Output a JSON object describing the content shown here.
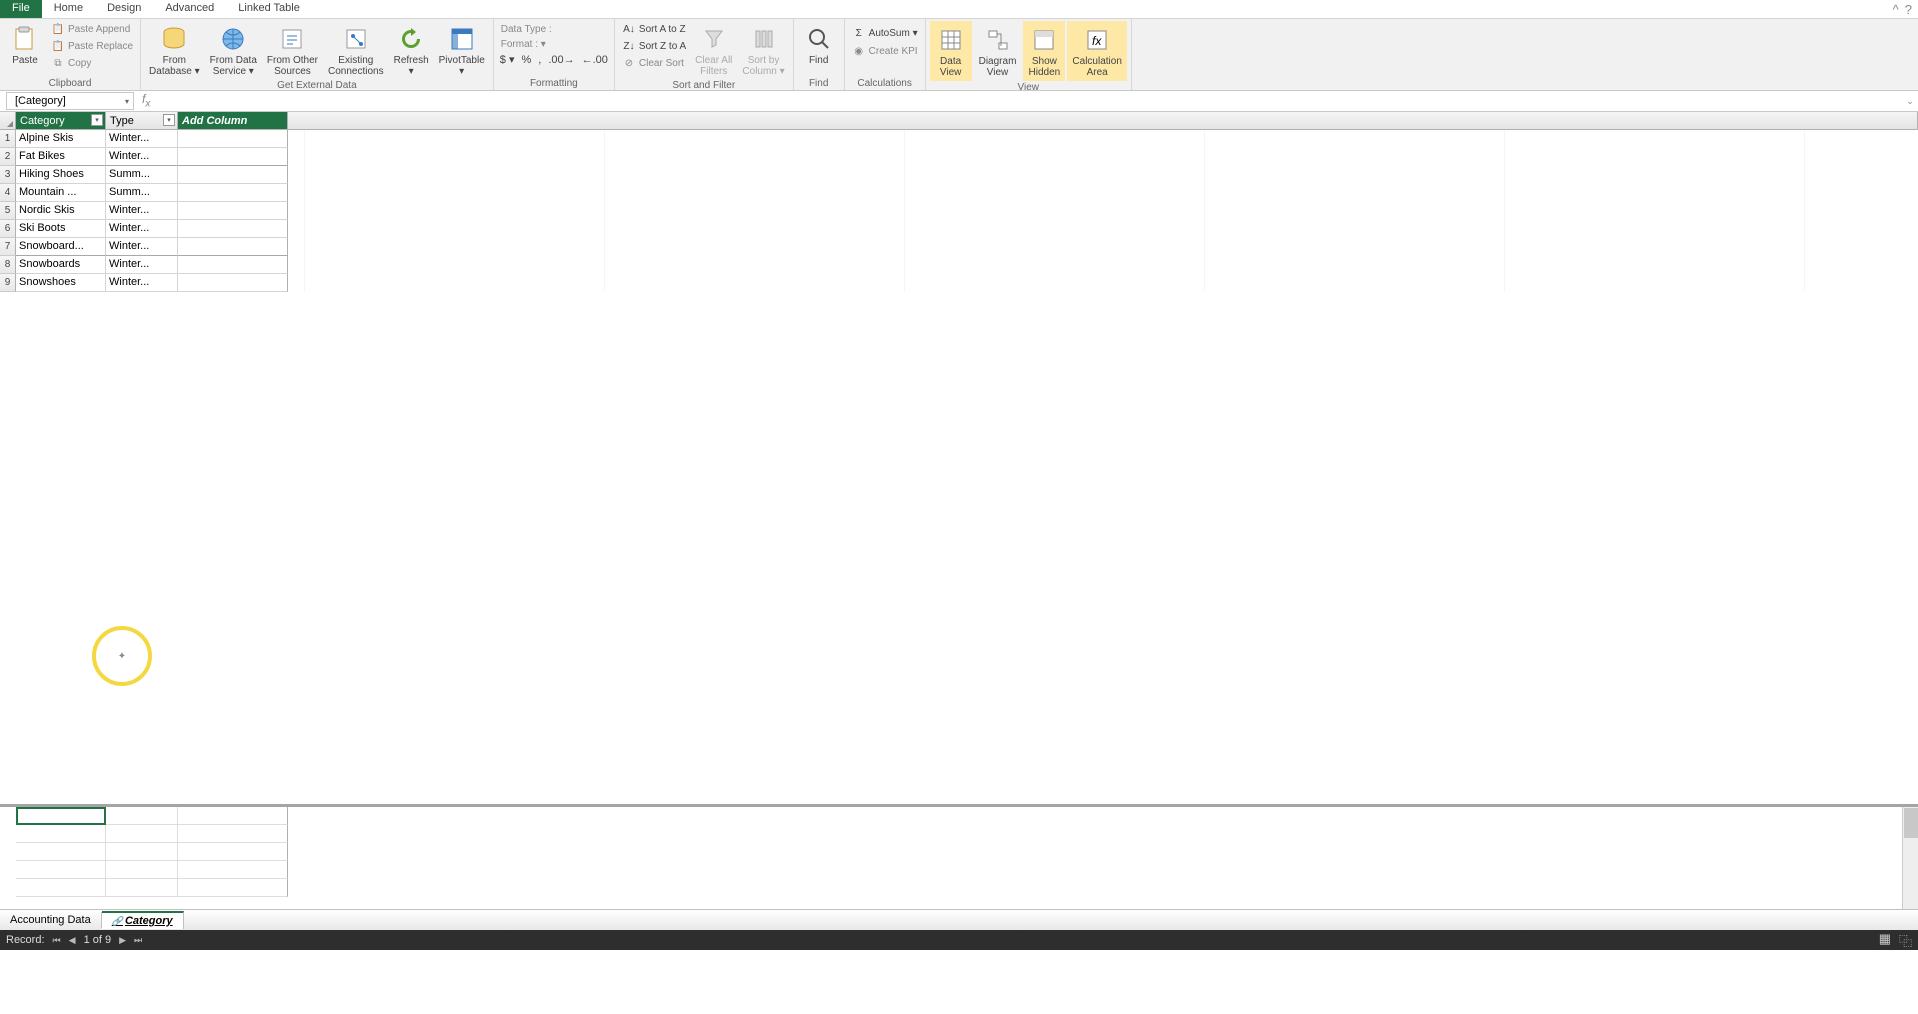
{
  "tabs": {
    "file": "File",
    "home": "Home",
    "design": "Design",
    "advanced": "Advanced",
    "linked_table": "Linked Table"
  },
  "ribbon": {
    "clipboard": {
      "label": "Clipboard",
      "paste": "Paste",
      "paste_append": "Paste Append",
      "paste_replace": "Paste Replace",
      "copy": "Copy"
    },
    "get_external": {
      "label": "Get External Data",
      "from_db": "From\nDatabase ▾",
      "from_ds": "From Data\nService ▾",
      "from_other": "From Other\nSources",
      "existing": "Existing\nConnections",
      "refresh": "Refresh\n▾",
      "pivot": "PivotTable\n▾"
    },
    "formatting": {
      "label": "Formatting",
      "data_type": "Data Type :",
      "format": "Format : ▾"
    },
    "sort_filter": {
      "label": "Sort and Filter",
      "a_to_z": "Sort A to Z",
      "z_to_a": "Sort Z to A",
      "clear_sort": "Clear Sort",
      "clear_filters": "Clear All\nFilters",
      "sort_by_col": "Sort by\nColumn ▾"
    },
    "find": {
      "label": "Find",
      "find": "Find"
    },
    "calculations": {
      "label": "Calculations",
      "autosum": "AutoSum ▾",
      "create_kpi": "Create KPI"
    },
    "view": {
      "label": "View",
      "data_view": "Data\nView",
      "diagram_view": "Diagram\nView",
      "show_hidden": "Show\nHidden",
      "calc_area": "Calculation\nArea"
    }
  },
  "name_box": "[Category]",
  "columns": {
    "category": "Category",
    "type": "Type",
    "add": "Add Column"
  },
  "rows": [
    {
      "n": "1",
      "category": "Alpine Skis",
      "type": "Winter..."
    },
    {
      "n": "2",
      "category": "Fat Bikes",
      "type": "Winter..."
    },
    {
      "n": "3",
      "category": "Hiking Shoes",
      "type": "Summ..."
    },
    {
      "n": "4",
      "category": "Mountain ...",
      "type": "Summ..."
    },
    {
      "n": "5",
      "category": "Nordic Skis",
      "type": "Winter..."
    },
    {
      "n": "6",
      "category": "Ski Boots",
      "type": "Winter..."
    },
    {
      "n": "7",
      "category": "Snowboard...",
      "type": "Winter..."
    },
    {
      "n": "8",
      "category": "Snowboards",
      "type": "Winter..."
    },
    {
      "n": "9",
      "category": "Snowshoes",
      "type": "Winter..."
    }
  ],
  "sheet_tabs": {
    "accounting": "Accounting Data",
    "category": "Category"
  },
  "status": {
    "record": "Record:",
    "pos": "1 of 9"
  }
}
